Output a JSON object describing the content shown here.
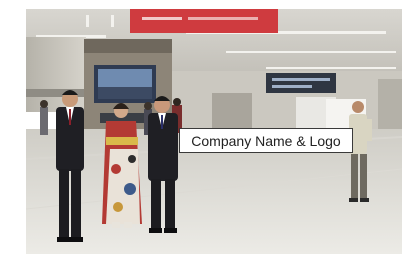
{
  "photo": {
    "scene": "airport arrivals hall",
    "sign_text": "Company Name & Logo",
    "colors": {
      "ceiling": "#c9c6bf",
      "floor": "#e4e3de",
      "banner": "#cf3b3f",
      "suit": "#1f1f24",
      "kimono": "#b33a34"
    }
  }
}
